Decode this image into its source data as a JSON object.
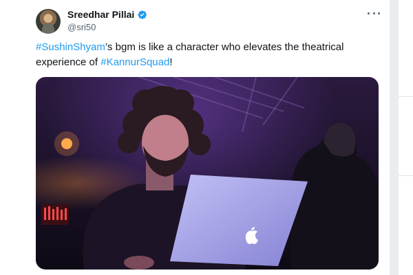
{
  "tweet": {
    "author_name": "Sreedhar Pillai",
    "author_handle": "@sri50",
    "text_parts": [
      {
        "type": "hashtag",
        "text": "#SushinShyam"
      },
      {
        "type": "text",
        "text": "’s bgm is like a character who elevates the theatrical experience of "
      },
      {
        "type": "hashtag",
        "text": "#KannurSquad"
      },
      {
        "type": "text",
        "text": "!"
      }
    ],
    "media_alt": "Musician with curly hair working on a laptop in purple stage lighting"
  },
  "icons": {
    "verified": "verified-badge-icon",
    "more": "more-options-icon",
    "laptop_logo": "apple-logo-icon"
  },
  "colors": {
    "link": "#1d9bf0",
    "verified": "#1d9bf0",
    "text": "#0f1419",
    "secondary": "#536471"
  }
}
